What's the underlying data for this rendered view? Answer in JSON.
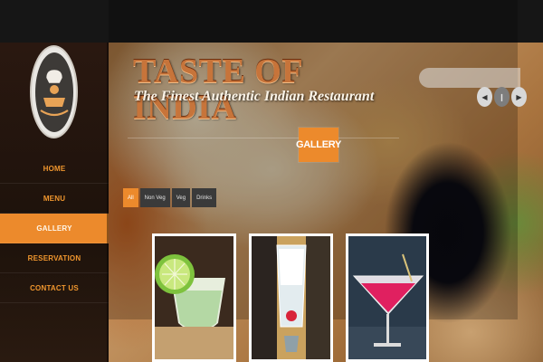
{
  "site": {
    "title": "TASTE OF INDIA",
    "tagline": "The Finest Authentic Indian Restaurant"
  },
  "nav": {
    "items": [
      {
        "label": "HOME",
        "active": false
      },
      {
        "label": "MENU",
        "active": false
      },
      {
        "label": "GALLERY",
        "active": true
      },
      {
        "label": "RESERVATION",
        "active": false
      },
      {
        "label": "CONTACT US",
        "active": false
      }
    ]
  },
  "search": {
    "placeholder": "",
    "value": ""
  },
  "slider_arrows": {
    "prev_icon": "chevron-left-icon",
    "pause_icon": "pause-icon",
    "next_icon": "chevron-right-icon"
  },
  "section": {
    "title": "GALLERY"
  },
  "filters": [
    {
      "label": "All",
      "active": true
    },
    {
      "label": "Non Veg",
      "active": false
    },
    {
      "label": "Veg",
      "active": false
    },
    {
      "label": "Drinks",
      "active": false
    }
  ],
  "gallery": [
    {
      "icon": "margarita-with-lime-icon"
    },
    {
      "icon": "shaved-ice-drink-icon"
    },
    {
      "icon": "red-cocktail-icon"
    }
  ],
  "colors": {
    "accent": "#ec8a2c",
    "sidebar": "#1d120b",
    "nav_text": "#f0962e"
  }
}
